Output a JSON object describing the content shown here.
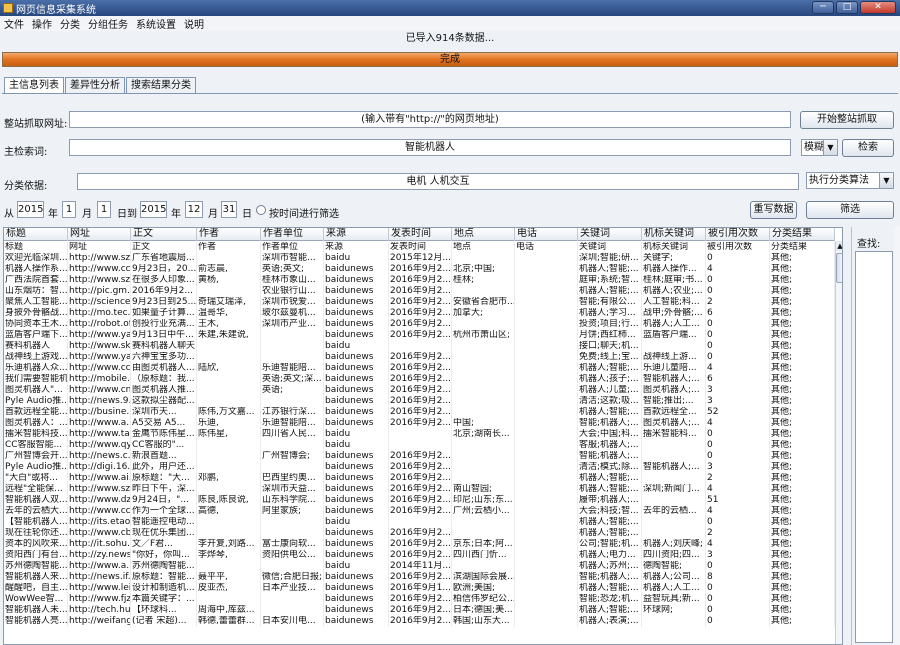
{
  "window": {
    "title": "网页信息采集系统"
  },
  "menu": [
    "文件",
    "操作",
    "分类",
    "分组任务",
    "系统设置",
    "说明"
  ],
  "status": {
    "import_message": "已导入914条数据..."
  },
  "progress": {
    "label": "完成",
    "percent": 100
  },
  "tabs": [
    "主信息列表",
    "差异性分析",
    "搜索结果分类"
  ],
  "form": {
    "url_label": "整站抓取网址:",
    "url_placeholder": "(输入带有\"http://\"的网页地址)",
    "crawl_button": "开始整站抓取",
    "keyword_label": "主检索词:",
    "keyword_value": "智能机器人",
    "match_mode": "模糊",
    "search_button": "检索",
    "category_label": "分类依据:",
    "category_value": "电机 人机交互",
    "algo": "执行分类算法",
    "from_label": "从",
    "year1": "2015",
    "year_label1": "年",
    "month1": "1",
    "month_label1": "月",
    "day1": "1",
    "to_label": "日到",
    "year2": "2015",
    "year_label2": "年",
    "month2": "12",
    "month_label2": "月",
    "day2": "31",
    "day_label2": "日",
    "time_filter_label": "按时间进行筛选",
    "rewrite_button": "重写数据",
    "filter_button": "筛选"
  },
  "side": {
    "label": "查找:"
  },
  "table": {
    "headers": [
      "标题",
      "网址",
      "正文",
      "作者",
      "作者单位",
      "来源",
      "发表时间",
      "地点",
      "电话",
      "关键词",
      "机标关键词",
      "被引用次数",
      "分类结果"
    ],
    "rows": [
      [
        "标题",
        "网址",
        "正文",
        "作者",
        "作者单位",
        "来源",
        "发表时间",
        "地点",
        "电话",
        "关键词",
        "机标关键词",
        "被引用次数",
        "分类结果"
      ],
      [
        "欢迎光临深圳...",
        "http://www.sz...",
        "广东省地震局...",
        "",
        "深圳市智能...",
        "baidu",
        "2015年12月...",
        "",
        "",
        "深圳;智能;研...",
        "关键字;",
        "0",
        "其他;"
      ],
      [
        "机器人操作系...",
        "http://www.cc...",
        "9月23日，20...",
        "俞志晨,",
        "英语;英文;",
        "baidunews",
        "2016年9月2...",
        "北京;中国;",
        "",
        "机器人;智能;...",
        "机器人操作...",
        "4",
        "其他;"
      ],
      [
        "广西法院首套...",
        "http://www.sz...",
        "在很多人印象...",
        "黄杨,",
        "桂林市象山...",
        "baidunews",
        "2016年9月2...",
        "桂林;",
        "",
        "庭审;系统;智...",
        "桂林;庭审;书...",
        "0",
        "其他;"
      ],
      [
        "山东烟坊：智...",
        "http://pic.gm...",
        "2016年9月2...",
        "",
        "农业银行山...",
        "baidunews",
        "2016年9月2...",
        "",
        "",
        "机器人;智能;...",
        "机器人;农业;...",
        "0",
        "其他;"
      ],
      [
        "聚焦人工智能...",
        "http://science...",
        "9月23日到25...",
        "奇瑞艾瑞泽,",
        "深圳市锐爱...",
        "baidunews",
        "2016年9月2...",
        "安徽省合肥市...",
        "",
        "智能;有限公...",
        "人工智能;科...",
        "2",
        "其他;"
      ],
      [
        "身披外骨骼战...",
        "http://mo.tec...",
        "如果量子计算...",
        "温哥华,",
        "玻尔兹曼机...",
        "baidunews",
        "2016年9月2...",
        "加拿大;",
        "",
        "机器人;学习...",
        "战甲;外骨骼;...",
        "6",
        "其他;"
      ],
      [
        "协同资本王木...",
        "http://robot.of...",
        "创投行业充满...",
        "王木,",
        "深圳市产业...",
        "baidunews",
        "2016年9月2...",
        "",
        "",
        "投资;项目;行...",
        "机器人;人工...",
        "0",
        "其他;"
      ],
      [
        "蓝盾客户端下...",
        "http://www.ya...",
        "9月13日中午...",
        "朱建,朱建说,",
        "",
        "baidunews",
        "2016年9月2...",
        "杭州市萧山区;",
        "",
        "月饼;西红柿...",
        "蓝盾客户端...",
        "0",
        "其他;"
      ],
      [
        "赛科机器人",
        "http://www.sk...",
        "赛科机器人聊天...",
        "",
        "",
        "baidu",
        "",
        "",
        "",
        "接口;聊天;机...",
        "",
        "0",
        "其他;"
      ],
      [
        "战神线上游戏...",
        "http://www.ya...",
        "六神宝宝多功...",
        "",
        "",
        "baidunews",
        "2016年9月2...",
        "",
        "",
        "免费;线上;宝...",
        "战神线上游...",
        "0",
        "其他;"
      ],
      [
        "乐迪机器人众...",
        "http://www.cc...",
        "由图灵机器人...",
        "陆欣,",
        "乐迪智能陪...",
        "baidunews",
        "2016年9月2...",
        "",
        "",
        "机器人;智能;...",
        "乐迪儿童陪...",
        "4",
        "其他;"
      ],
      [
        "我们需要智能机...",
        "http://mobile....",
        "（原标题：我...",
        "",
        "英语;英文;深...",
        "baidunews",
        "2016年9月2...",
        "",
        "",
        "机器人;孩子;...",
        "智能机器人;...",
        "6",
        "其他;"
      ],
      [
        "图灵机器人\"...",
        "http://www.cn...",
        "图灵机器人推...",
        "",
        "英语;",
        "baidunews",
        "2016年9月2...",
        "",
        "",
        "机器人;儿童;...",
        "图灵机器人;...",
        "3",
        "其他;"
      ],
      [
        "Pyle Audio推...",
        "http://news.9...",
        "这款拟尘器配...",
        "",
        "",
        "baidunews",
        "2016年9月2...",
        "",
        "",
        "清洁;这款;吸...",
        "智能;推出;...",
        "3",
        "其他;"
      ],
      [
        "首款远程全能...",
        "http://busine...",
        "深圳市天...",
        "陈伟,万文嘉...",
        "江苏银行深...",
        "baidunews",
        "2016年9月2...",
        "",
        "",
        "机器人;智能;...",
        "首款远程全...",
        "52",
        "其他;"
      ],
      [
        "图灵机器人：...",
        "http://www.a...",
        "A5交易 A5...",
        "乐迪,",
        "乐迪智能陪...",
        "baidunews",
        "2016年9月2...",
        "中国;",
        "",
        "智能;机器人;...",
        "图灵机器人;...",
        "4",
        "其他;"
      ],
      [
        "擂米智能科技...",
        "http://www.ta...",
        "金鹰节陈伟星...",
        "陈伟星,",
        "四川省人民...",
        "baidu",
        "",
        "北京;湖南长...",
        "",
        "大会;中国;科...",
        "擂米智能科...",
        "0",
        "其他;"
      ],
      [
        "CC客服智能...",
        "http://www.qy...",
        "CC客服的\"...",
        "",
        "",
        "baidu",
        "",
        "",
        "",
        "客服;机器人;...",
        "",
        "0",
        "其他;"
      ],
      [
        "广州智博会开...",
        "http://news.c...",
        "新浪首题...",
        "",
        "广州智博会;",
        "baidunews",
        "2016年9月2...",
        "",
        "",
        "智能;机器人;...",
        "",
        "0",
        "其他;"
      ],
      [
        "Pyle Audio推...",
        "http://digi.16...",
        "此外，用户还...",
        "",
        "",
        "baidunews",
        "2016年9月2...",
        "",
        "",
        "清洁;模式;除...",
        "智能机器人;...",
        "3",
        "其他;"
      ],
      [
        "\"大白\"或将...",
        "http://www.ai...",
        "原标题：\"大...",
        "邓鹏,",
        "巴西里约奥...",
        "baidunews",
        "2016年9月2...",
        "",
        "",
        "机器人;智能;...",
        "",
        "2",
        "其他;"
      ],
      [
        "远程\"全能保...",
        "http://www.sz...",
        "昨日下午，深...",
        "",
        "深圳市天益...",
        "baidunews",
        "2016年9月2...",
        "南山智园;",
        "",
        "机器人;智能;...",
        "深圳;新闻门...",
        "4",
        "其他;"
      ],
      [
        "智能机器人双...",
        "http://www.dz...",
        "9月24日，\"...",
        "陈良,陈良说,",
        "山东科学院...",
        "baidunews",
        "2016年9月2...",
        "印尼;山东;东...",
        "",
        "履带;机器人;...",
        "",
        "51",
        "其他;"
      ],
      [
        "去年的云栖大...",
        "http://www.cc...",
        "作为一个全球...",
        "高德,",
        "阿里家族;",
        "baidunews",
        "2016年9月2...",
        "广州;云栖小...",
        "",
        "大会;科技;智...",
        "去年的云栖...",
        "4",
        "其他;"
      ],
      [
        "【智能机器人...",
        "http://its.etao.c...",
        "智能遥控电动...",
        "",
        "",
        "baidu",
        "",
        "",
        "",
        "机器人;智能;...",
        "",
        "0",
        "其他;"
      ],
      [
        "现在往轮你还...",
        "http://www.cb...",
        "现在优乐集团...",
        "",
        "",
        "baidunews",
        "2016年9月2...",
        "",
        "",
        "机器人;智能;...",
        "",
        "2",
        "其他;"
      ],
      [
        "资本的风吹来...",
        "http://it.sohu....",
        "文／F君...",
        "李开复,刘路...",
        "富士康向软...",
        "baidunews",
        "2016年9月2...",
        "京东;日本;阿...",
        "",
        "公司;智能;机...",
        "机器人;刘庆峰;",
        "4",
        "其他;"
      ],
      [
        "资阳西门有台...",
        "http://zy.news...",
        "\"你好，你叫...",
        "李烨琴,",
        "资阳供电公...",
        "baidunews",
        "2016年9月2...",
        "四川西门忻...",
        "",
        "机器人;电力...",
        "四川资阳;四...",
        "3",
        "其他;"
      ],
      [
        "苏州德陶智能...",
        "http://www.a...",
        "苏州德陶智能...",
        "",
        "",
        "baidu",
        "2014年11月...",
        "",
        "",
        "机器人;苏州;...",
        "德陶智能;",
        "0",
        "其他;"
      ],
      [
        "智能机器人来...",
        "http://news.if...",
        "原标题：智能...",
        "聂平平,",
        "微信;合肥日报;",
        "baidunews",
        "2016年9月2...",
        "滨湖国际会展...",
        "",
        "智能;机器人;...",
        "机器人;公司...",
        "8",
        "其他;"
      ],
      [
        "醒醒吧，自主...",
        "http://www.lei...",
        "设计和制造机...",
        "皮亚杰,",
        "日本产业技...",
        "baidunews",
        "2016年9月1...",
        "欧洲;美国;",
        "",
        "机器人;智能;...",
        "机器人;人工...",
        "0",
        "其他;"
      ],
      [
        "WowWee智...",
        "http://www.fjz...",
        "本篇关键字：...",
        "",
        "",
        "baidunews",
        "2016年9月2...",
        "柏信伟罗纪公...",
        "",
        "智能;恐龙;机...",
        "益智玩具;新...",
        "0",
        "其他;"
      ],
      [
        "智能机器人未...",
        "http://tech.hu...",
        "【环球科...",
        "周海中,库兹...",
        "",
        "baidunews",
        "2016年9月2...",
        "日本;德国;美...",
        "",
        "机器人;智能;...",
        "环球网;",
        "0",
        "其他;"
      ],
      [
        "智能机器人亮...",
        "http://weifang...",
        "(记者 宋超)...",
        "韩德,蕾蕾群...",
        "日本安川电...",
        "baidunews",
        "2016年9月2...",
        "韩国;山东大...",
        "",
        "机器人;表演;...",
        "",
        "0",
        "其他;"
      ]
    ]
  }
}
